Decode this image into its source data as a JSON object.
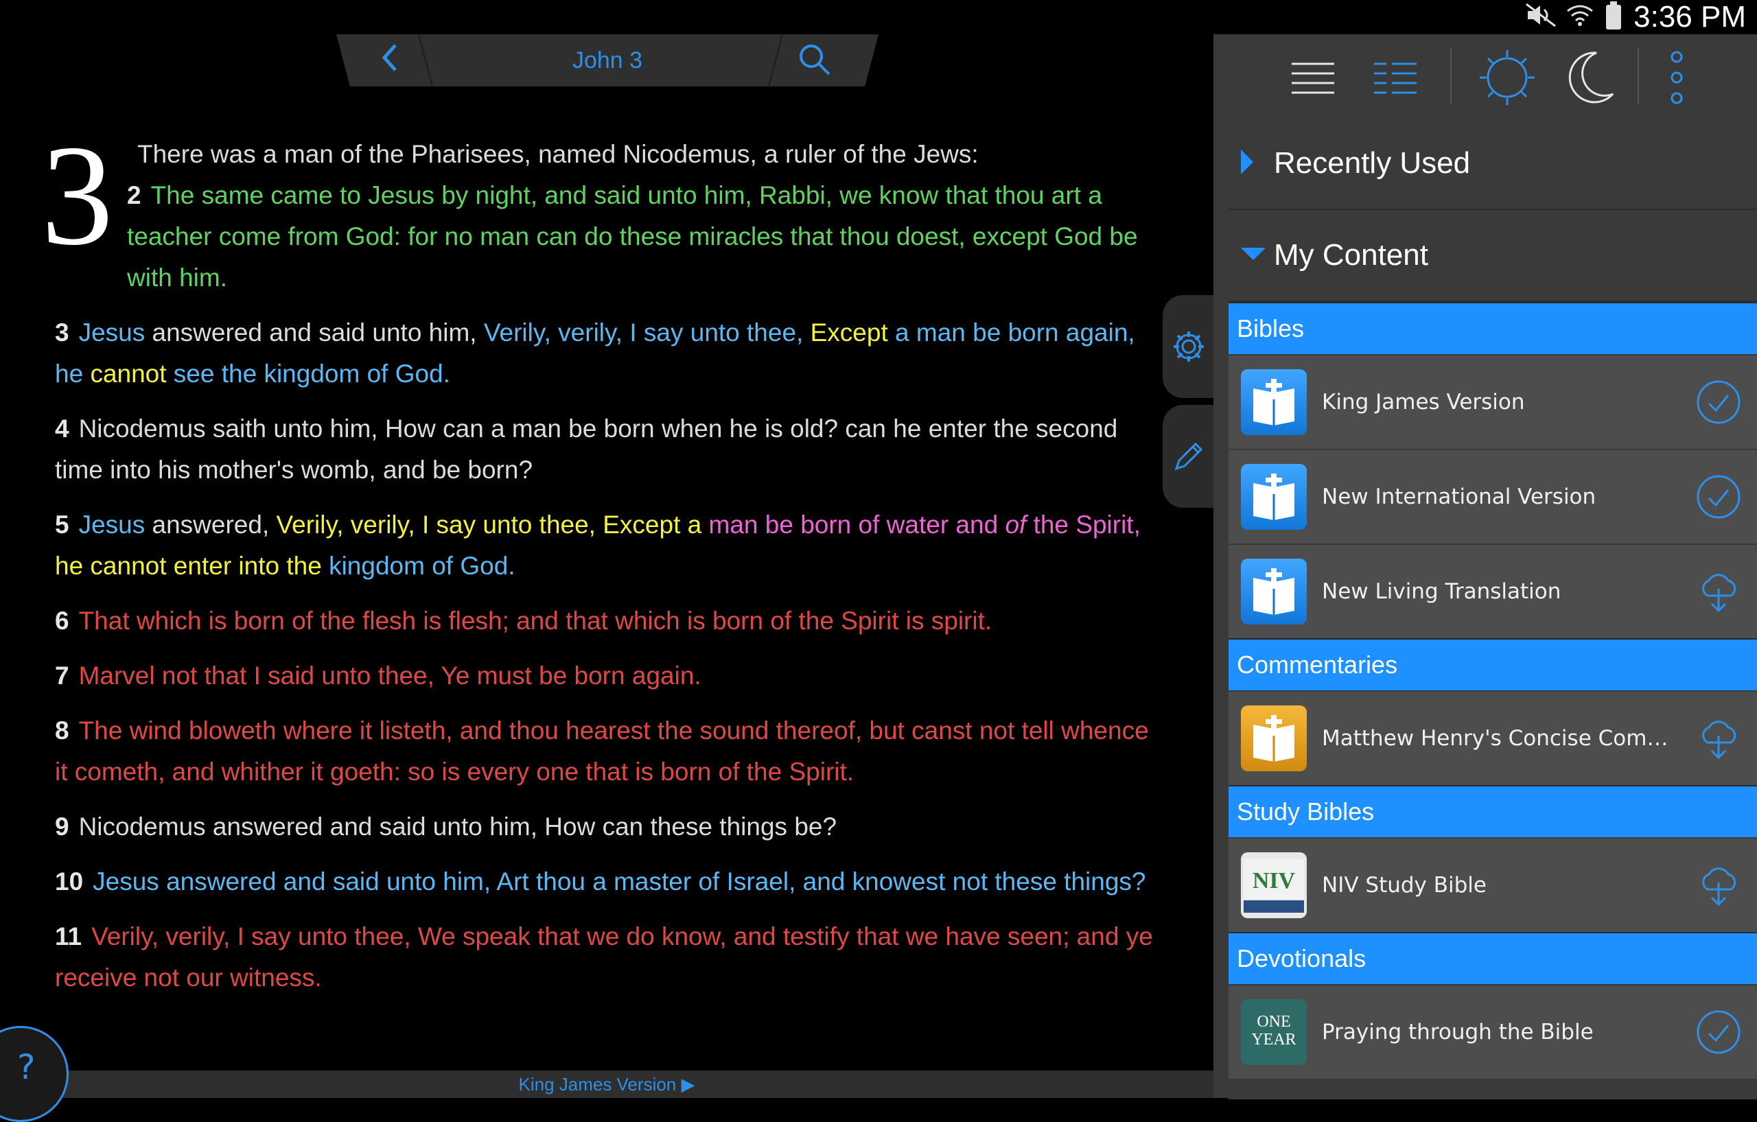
{
  "status_bar": {
    "time": "3:36 PM"
  },
  "nav": {
    "title": "John 3"
  },
  "reader": {
    "chapter": "3",
    "verses": [
      {
        "num": "",
        "segments": [
          {
            "t": "There was a man of the Pharisees, named Nicodemus, a ruler of the Jews:",
            "c": "white"
          }
        ]
      },
      {
        "num": "2",
        "segments": [
          {
            "t": "The same came to Jesus by night, and said unto him, Rabbi, we know that thou art a teacher come from God: for no man can do these miracles that thou doest, except God be with him.",
            "c": "green"
          }
        ]
      },
      {
        "num": "3",
        "segments": [
          {
            "t": "Jesus",
            "c": "blue"
          },
          {
            "t": " answered and said unto him, ",
            "c": "white"
          },
          {
            "t": "Verily, verily, I say unto thee, ",
            "c": "blue"
          },
          {
            "t": "Except",
            "c": "yellow"
          },
          {
            "t": " a man be born again, he ",
            "c": "blue"
          },
          {
            "t": "cannot",
            "c": "yellow"
          },
          {
            "t": " see the kingdom of God.",
            "c": "blue"
          }
        ]
      },
      {
        "num": "4",
        "segments": [
          {
            "t": "Nicodemus saith unto him, How can a man be born when he is old? can he enter the second time into his mother's womb, and be born?",
            "c": "white"
          }
        ]
      },
      {
        "num": "5",
        "segments": [
          {
            "t": "Jesus",
            "c": "blue"
          },
          {
            "t": " answered, ",
            "c": "white"
          },
          {
            "t": "Verily, verily, I say unto thee, Except a ",
            "c": "yellow"
          },
          {
            "t": "man be born of water and ",
            "c": "pink"
          },
          {
            "t": "of",
            "c": "pink",
            "i": true
          },
          {
            "t": " the Spirit, ",
            "c": "pink"
          },
          {
            "t": "he cannot enter into the ",
            "c": "yellow"
          },
          {
            "t": "kingdom of God.",
            "c": "blue"
          }
        ]
      },
      {
        "num": "6",
        "segments": [
          {
            "t": "That which is born of the flesh is flesh; and that which is born of the Spirit is spirit.",
            "c": "red"
          }
        ]
      },
      {
        "num": "7",
        "segments": [
          {
            "t": "Marvel not that I said unto thee, Ye must be born again.",
            "c": "red"
          }
        ]
      },
      {
        "num": "8",
        "segments": [
          {
            "t": "The wind bloweth where it listeth, and thou hearest the sound thereof, but canst not tell whence it cometh, and whither it goeth: so is every one that is born of the Spirit.",
            "c": "red"
          }
        ]
      },
      {
        "num": "9",
        "segments": [
          {
            "t": "Nicodemus answered and said unto him, How can these things be?",
            "c": "white"
          }
        ]
      },
      {
        "num": "10",
        "segments": [
          {
            "t": "Jesus answered and said unto him, Art thou a master of Israel, and knowest not these things?",
            "c": "blue"
          }
        ]
      },
      {
        "num": "11",
        "segments": [
          {
            "t": "Verily, verily, I say unto thee, We speak that we do know, and testify that we have seen; and ye receive not our witness.",
            "c": "red"
          }
        ]
      }
    ],
    "footer_label": "King James Version ▶",
    "help": "?"
  },
  "panel": {
    "recently_used": "Recently Used",
    "my_content": "My Content",
    "categories": [
      {
        "name": "Bibles",
        "items": [
          {
            "name": "King James Version",
            "icon": "blue-book",
            "action": "check"
          },
          {
            "name": "New International Version",
            "icon": "blue-book",
            "action": "check"
          },
          {
            "name": "New Living Translation",
            "icon": "blue-book",
            "action": "download"
          }
        ]
      },
      {
        "name": "Commentaries",
        "items": [
          {
            "name": "Matthew Henry's Concise Commentary",
            "icon": "gold-book",
            "action": "download"
          }
        ]
      },
      {
        "name": "Study Bibles",
        "items": [
          {
            "name": "NIV Study Bible",
            "icon": "niv",
            "action": "download"
          }
        ]
      },
      {
        "name": "Devotionals",
        "items": [
          {
            "name": "Praying through the Bible",
            "icon": "oneyear",
            "action": "check"
          }
        ]
      }
    ]
  },
  "colors": {
    "accent": "#1e90ff",
    "link": "#2e8fe8"
  }
}
